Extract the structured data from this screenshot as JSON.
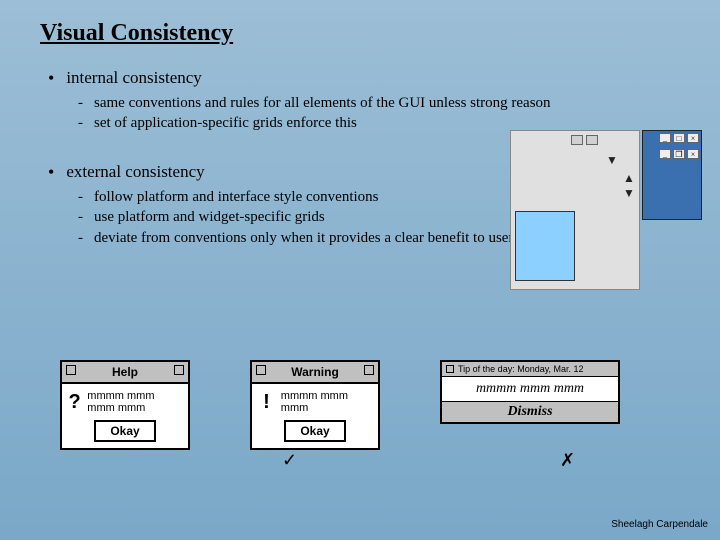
{
  "title": "Visual Consistency",
  "section1": {
    "heading": "internal consistency",
    "items": [
      "same conventions and rules for all elements of the GUI unless strong reason",
      "set of application-specific grids enforce this"
    ]
  },
  "section2": {
    "heading": "external consistency",
    "items": [
      "follow platform and interface style conventions",
      "use platform and widget-specific grids",
      "deviate from conventions only when it provides a clear benefit to user"
    ]
  },
  "dialogs": {
    "help": {
      "title": "Help",
      "icon": "?",
      "body": "mmmm mmm mmm mmm",
      "button": "Okay"
    },
    "warning": {
      "title": "Warning",
      "icon": "!",
      "body": "mmmm mmm mmm",
      "button": "Okay"
    },
    "tip": {
      "title": "Tip of the day: Monday, Mar. 12",
      "body": "mmmm mmm mmm",
      "button": "Dismiss"
    }
  },
  "marks": {
    "check": "✓",
    "cross": "✗"
  },
  "footer": "Sheelagh Carpendale"
}
